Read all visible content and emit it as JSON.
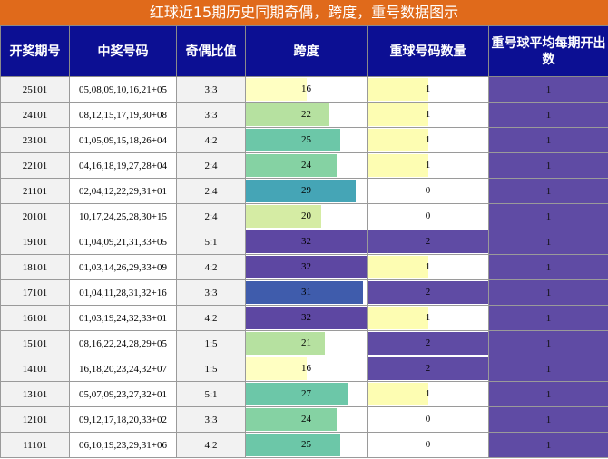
{
  "title": "红球近15期历史同期奇偶，跨度，重号数据图示",
  "columns": [
    "开奖期号",
    "中奖号码",
    "奇偶比值",
    "跨度",
    "重球号码数量",
    "重号球平均每期开出数"
  ],
  "colors": {
    "header_bg": "#0c0f93",
    "title_bg": "#e06a1b",
    "avg_bg": "#5f4ba4",
    "repeat_full": "#5f4ba4",
    "repeat_one": "#fdfdb2",
    "span_scale": [
      "#ffffc2",
      "#d5eca4",
      "#b6e1a0",
      "#85d2a3",
      "#6cc7a8",
      "#45a5b6",
      "#3f5cac",
      "#5d47a2"
    ]
  },
  "chart_data": {
    "type": "table",
    "title": "红球近15期历史同期奇偶，跨度，重号数据图示",
    "rows": [
      {
        "period": "25101",
        "numbers": "05,08,09,10,16,21+05",
        "odd_even": "3:3",
        "span": 16,
        "repeat": 1,
        "avg_repeat": 1
      },
      {
        "period": "24101",
        "numbers": "08,12,15,17,19,30+08",
        "odd_even": "3:3",
        "span": 22,
        "repeat": 1,
        "avg_repeat": 1
      },
      {
        "period": "23101",
        "numbers": "01,05,09,15,18,26+04",
        "odd_even": "4:2",
        "span": 25,
        "repeat": 1,
        "avg_repeat": 1
      },
      {
        "period": "22101",
        "numbers": "04,16,18,19,27,28+04",
        "odd_even": "2:4",
        "span": 24,
        "repeat": 1,
        "avg_repeat": 1
      },
      {
        "period": "21101",
        "numbers": "02,04,12,22,29,31+01",
        "odd_even": "2:4",
        "span": 29,
        "repeat": 0,
        "avg_repeat": 1
      },
      {
        "period": "20101",
        "numbers": "10,17,24,25,28,30+15",
        "odd_even": "2:4",
        "span": 20,
        "repeat": 0,
        "avg_repeat": 1
      },
      {
        "period": "19101",
        "numbers": "01,04,09,21,31,33+05",
        "odd_even": "5:1",
        "span": 32,
        "repeat": 2,
        "avg_repeat": 1
      },
      {
        "period": "18101",
        "numbers": "01,03,14,26,29,33+09",
        "odd_even": "4:2",
        "span": 32,
        "repeat": 1,
        "avg_repeat": 1
      },
      {
        "period": "17101",
        "numbers": "01,04,11,28,31,32+16",
        "odd_even": "3:3",
        "span": 31,
        "repeat": 2,
        "avg_repeat": 1
      },
      {
        "period": "16101",
        "numbers": "01,03,19,24,32,33+01",
        "odd_even": "4:2",
        "span": 32,
        "repeat": 1,
        "avg_repeat": 1
      },
      {
        "period": "15101",
        "numbers": "08,16,22,24,28,29+05",
        "odd_even": "1:5",
        "span": 21,
        "repeat": 2,
        "avg_repeat": 1
      },
      {
        "period": "14101",
        "numbers": "16,18,20,23,24,32+07",
        "odd_even": "1:5",
        "span": 16,
        "repeat": 2,
        "avg_repeat": 1
      },
      {
        "period": "13101",
        "numbers": "05,07,09,23,27,32+01",
        "odd_even": "5:1",
        "span": 27,
        "repeat": 1,
        "avg_repeat": 1
      },
      {
        "period": "12101",
        "numbers": "09,12,17,18,20,33+02",
        "odd_even": "3:3",
        "span": 24,
        "repeat": 0,
        "avg_repeat": 1
      },
      {
        "period": "11101",
        "numbers": "06,10,19,23,29,31+06",
        "odd_even": "4:2",
        "span": 25,
        "repeat": 0,
        "avg_repeat": 1
      }
    ],
    "span_max": 32,
    "repeat_max": 2
  }
}
